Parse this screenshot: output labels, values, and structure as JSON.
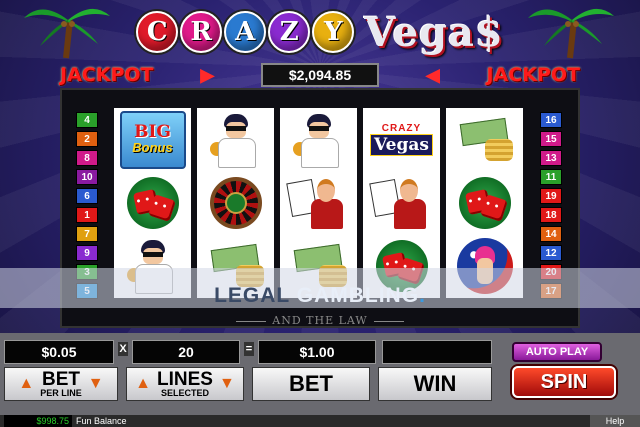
{
  "game": {
    "logo_word1_letters": [
      "C",
      "R",
      "A",
      "Z",
      "Y"
    ],
    "logo_ball_colors": [
      "#e01a2a",
      "#e01a8a",
      "#2a7ad0",
      "#8a2ad0",
      "#e8b010"
    ],
    "logo_word2": "Vega$"
  },
  "jackpot": {
    "left_label": "JACKPOT",
    "right_label": "JACKPOT",
    "value": "$2,094.85"
  },
  "paylines": {
    "left": [
      {
        "n": "4",
        "color": "#2aa02a"
      },
      {
        "n": "2",
        "color": "#e06010"
      },
      {
        "n": "8",
        "color": "#d01a8a"
      },
      {
        "n": "10",
        "color": "#8a1aa0"
      },
      {
        "n": "6",
        "color": "#2a5ad0"
      },
      {
        "n": "1",
        "color": "#e01818"
      },
      {
        "n": "7",
        "color": "#e0a010"
      },
      {
        "n": "9",
        "color": "#8a2ad0"
      },
      {
        "n": "3",
        "color": "#2aa02a"
      },
      {
        "n": "5",
        "color": "#1a8ad0"
      }
    ],
    "right": [
      {
        "n": "16",
        "color": "#2a5ad0"
      },
      {
        "n": "15",
        "color": "#d01a8a"
      },
      {
        "n": "13",
        "color": "#d01a8a"
      },
      {
        "n": "11",
        "color": "#2aa02a"
      },
      {
        "n": "19",
        "color": "#e01818"
      },
      {
        "n": "18",
        "color": "#e01818"
      },
      {
        "n": "14",
        "color": "#e06010"
      },
      {
        "n": "12",
        "color": "#2a5ad0"
      },
      {
        "n": "20",
        "color": "#e01818"
      },
      {
        "n": "17",
        "color": "#e06010"
      }
    ]
  },
  "reels": [
    [
      "big-bonus-symbol",
      "red-dice-symbol",
      "elvis-symbol"
    ],
    [
      "elvis-symbol",
      "roulette-symbol",
      "cash-symbol"
    ],
    [
      "elvis-symbol",
      "dealer-symbol",
      "cash-symbol"
    ],
    [
      "crazy-vegas-symbol",
      "dealer-symbol",
      "red-dice-symbol"
    ],
    [
      "cash-symbol",
      "red-dice-symbol",
      "showgirl-symbol"
    ]
  ],
  "symbols": {
    "big_bonus_line1": "BIG",
    "big_bonus_line2": "Bonus",
    "crazy_vegas_line1": "CRAZY",
    "crazy_vegas_line2": "Vegas"
  },
  "watermark": {
    "word1": "LEGAL",
    "word2": "GAMBLING",
    "dot": ".",
    "subtitle": "AND THE LAW"
  },
  "controls": {
    "bet_per_line_value": "$0.05",
    "multiply_sign": "X",
    "lines_value": "20",
    "equals_sign": "=",
    "total_bet_value": "$1.00",
    "win_value": "",
    "bet_per_line_label": "BET",
    "bet_per_line_sub": "PER LINE",
    "lines_label": "LINES",
    "lines_sub": "SELECTED",
    "bet_label": "BET",
    "win_label": "WIN",
    "autoplay_label": "AUTO PLAY",
    "spin_label": "SPIN"
  },
  "status": {
    "balance": "$998.75",
    "mode": "Fun Balance",
    "help": "Help"
  }
}
